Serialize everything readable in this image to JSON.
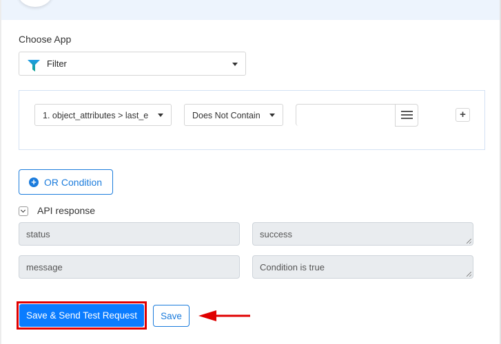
{
  "header": {},
  "choose_app": {
    "label": "Choose App",
    "selected_app": "Filter",
    "icon": "filter-funnel-icon"
  },
  "condition": {
    "field": "1. object_attributes > last_e",
    "operator": "Does Not Contain",
    "value": "",
    "menu_icon": "hamburger-icon",
    "add_icon": "plus-icon"
  },
  "or_condition": {
    "label": "OR Condition",
    "icon": "plus-circle-icon"
  },
  "api_response": {
    "label": "API response",
    "rows": [
      {
        "key": "status",
        "value": "success"
      },
      {
        "key": "message",
        "value": "Condition is true"
      }
    ]
  },
  "actions": {
    "save_send_label": "Save & Send Test Request",
    "save_label": "Save"
  },
  "annotation": {
    "highlight_color": "#e00000",
    "arrow_color": "#e00000"
  },
  "colors": {
    "primary": "#0a7cff",
    "link_blue": "#1a7bdc",
    "header_band": "#edf4fd"
  }
}
